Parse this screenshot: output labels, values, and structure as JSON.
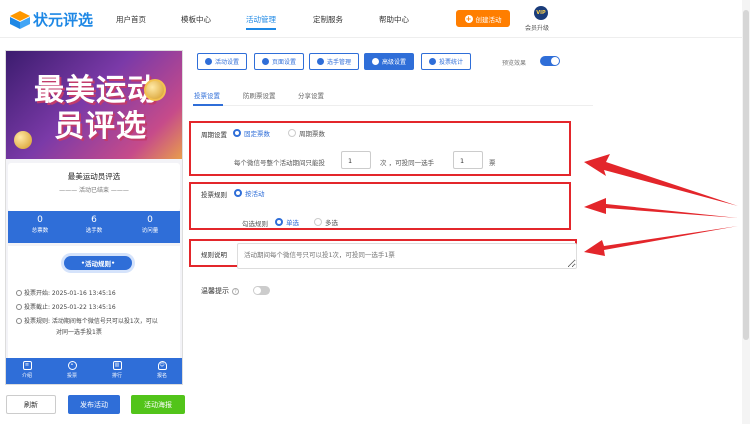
{
  "header": {
    "logo_text": "状元评选",
    "nav": [
      "用户首页",
      "模板中心",
      "活动管理",
      "定制服务",
      "帮助中心"
    ],
    "create_label": "创建活动",
    "vip_badge": "VIP",
    "vip_label": "会员升级"
  },
  "preview": {
    "banner_line1": "最美运动",
    "banner_line2": "员评选",
    "title": "最美运动员评选",
    "status": "活动已结束",
    "stats": [
      {
        "value": "0",
        "label": "总票数"
      },
      {
        "value": "6",
        "label": "选手数"
      },
      {
        "value": "0",
        "label": "访问量"
      }
    ],
    "rules_tag": "活动规则",
    "rules": [
      "投票开始: 2025-01-16 13:45:16",
      "投票截止: 2025-01-22 13:45:16",
      "投票规则: 活动期间每个微信号只可以投1次，可以",
      "对同一选手投1票"
    ],
    "tabbar": [
      "介绍",
      "投票",
      "排行",
      "报名"
    ]
  },
  "footer": {
    "refresh": "刷新",
    "publish": "发布活动",
    "poster": "活动海报"
  },
  "toolbar": {
    "tools": [
      "活动设置",
      "页面设置",
      "选手管理",
      "高级设置",
      "投票统计"
    ],
    "preview_label": "预览效果"
  },
  "subtabs": [
    "投票设置",
    "防刷票设置",
    "分享设置"
  ],
  "form": {
    "period_label": "周期设置",
    "period_opts": [
      "固定票数",
      "周期票数"
    ],
    "vote_text1": "每个微信号整个活动期间只能投",
    "vote_count": "1",
    "vote_text2": "次 ，可投同一选手",
    "same_count": "1",
    "vote_text3": "票",
    "rule_label": "投票规则",
    "rule_opt": "按活动",
    "check_label": "勾选规则",
    "check_opts": [
      "单选",
      "多选"
    ],
    "desc_label": "规则说明",
    "desc_placeholder": "活动期间每个微信号只可以投1次，可投同一选手1票",
    "tip_label": "温馨提示",
    "tip_icon": "?"
  },
  "colors": {
    "accent": "#2f6ed8",
    "orange": "#ff7e00",
    "highlight": "#e3262b",
    "green": "#52c41a"
  }
}
